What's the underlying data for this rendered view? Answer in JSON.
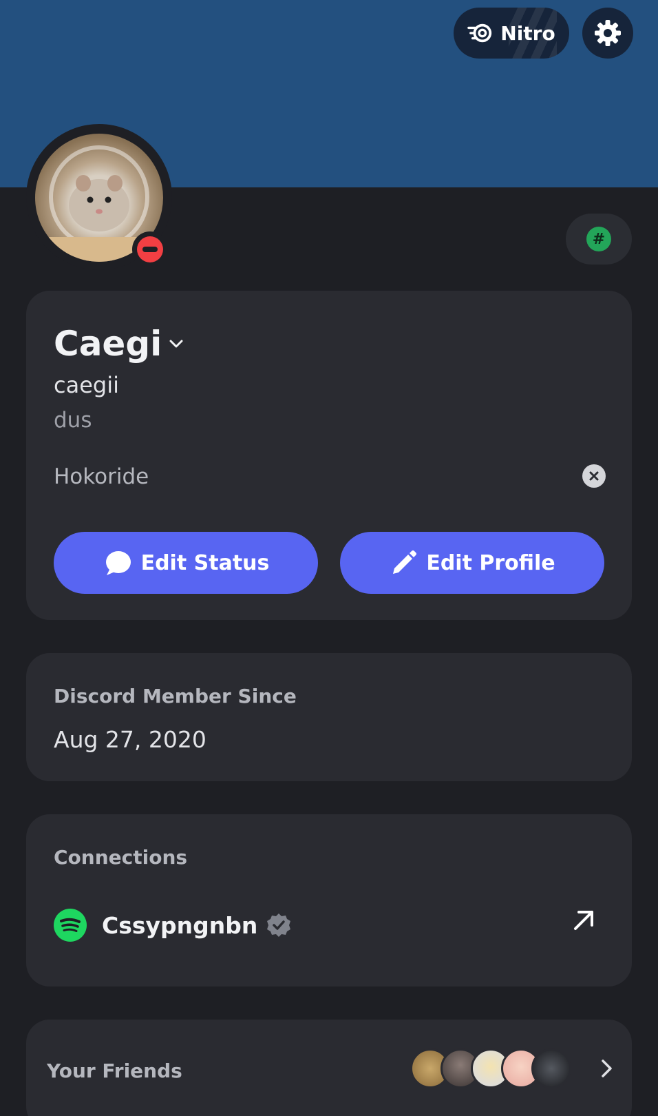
{
  "header": {
    "nitro_label": "Nitro",
    "colors": {
      "banner": "#23507f",
      "button_bg": "#16243a"
    }
  },
  "profile": {
    "status": "do-not-disturb",
    "tag_icon": "hashtag-icon",
    "display_name": "Caegi",
    "username": "caegii",
    "pronouns": "dus",
    "custom_status": "Hokoride",
    "edit_status_label": "Edit Status",
    "edit_profile_label": "Edit Profile",
    "colors": {
      "accent": "#5865f2",
      "dnd": "#f23f43",
      "online": "#23a559"
    }
  },
  "member_since": {
    "title": "Discord Member Since",
    "date": "Aug 27, 2020"
  },
  "connections": {
    "title": "Connections",
    "items": [
      {
        "service": "spotify",
        "name": "Cssypngnbn",
        "verified": true
      }
    ]
  },
  "friends": {
    "title": "Your Friends",
    "avatar_count": 5
  }
}
